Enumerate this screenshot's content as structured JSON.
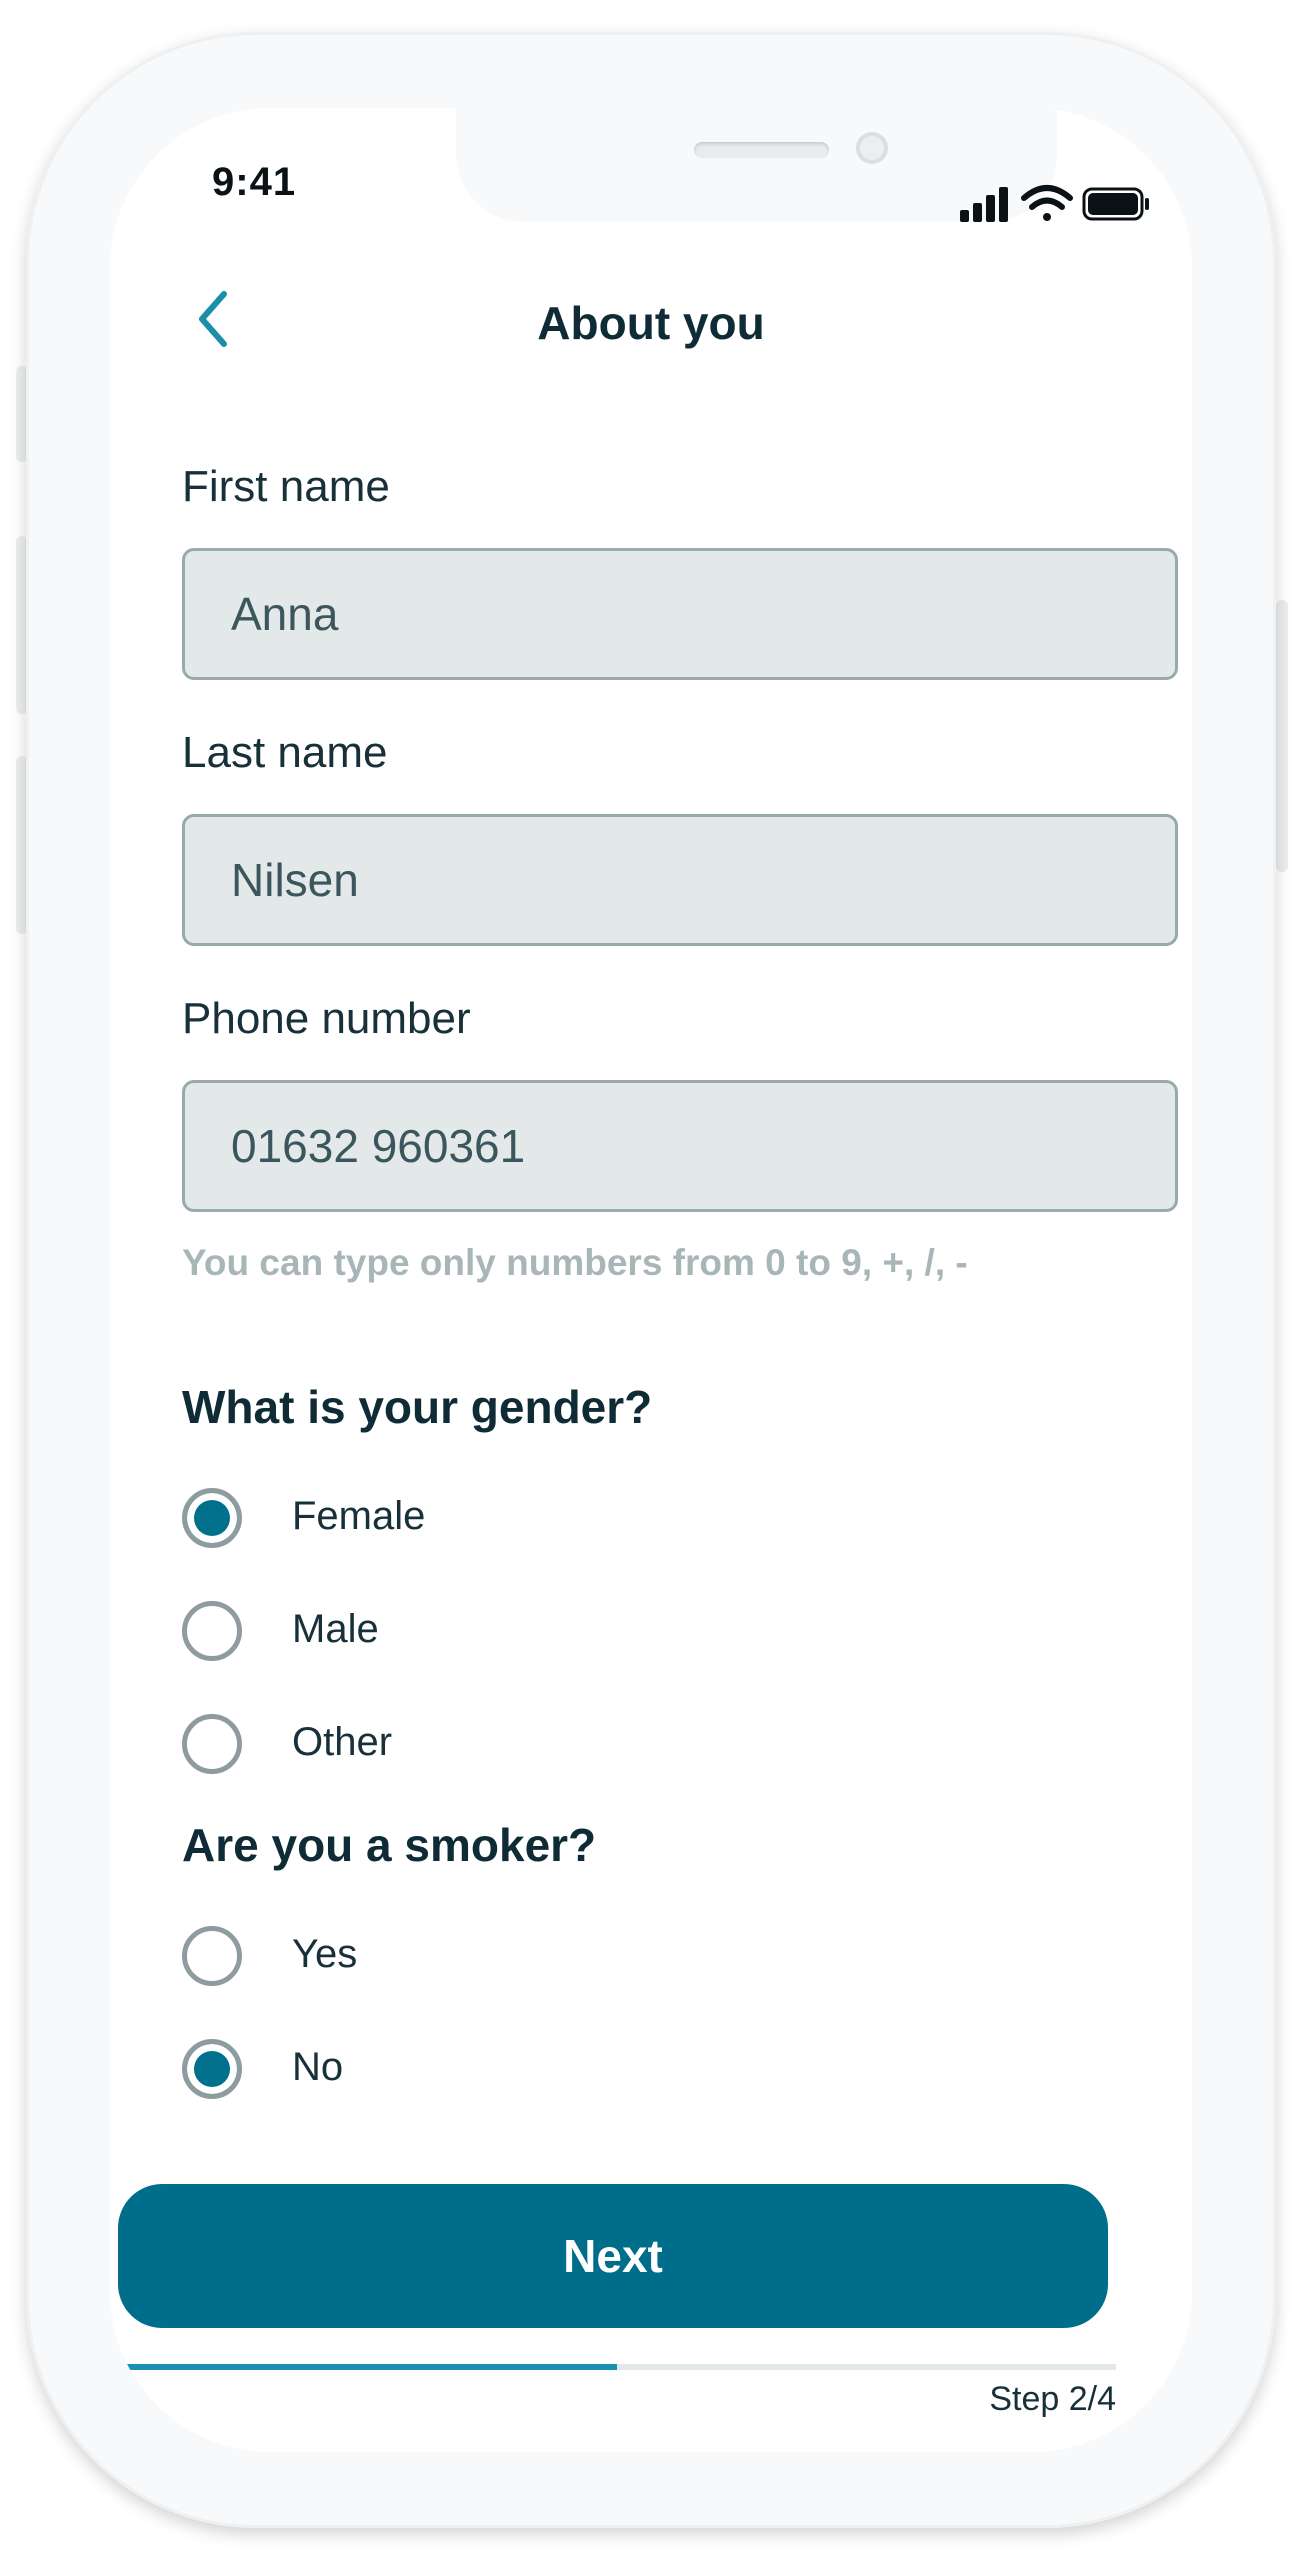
{
  "status_bar": {
    "time": "9:41",
    "signal_icon": "cellular-signal-icon",
    "wifi_icon": "wifi-icon",
    "battery_icon": "battery-icon"
  },
  "header": {
    "back_icon": "chevron-left-icon",
    "title": "About you"
  },
  "form": {
    "first_name": {
      "label": "First name",
      "value": "Anna"
    },
    "last_name": {
      "label": "Last name",
      "value": "Nilsen"
    },
    "phone": {
      "label": "Phone number",
      "value": "01632 960361",
      "hint": "You can type only numbers from 0 to 9, +, /, -"
    }
  },
  "gender": {
    "question": "What is your gender?",
    "options": [
      {
        "label": "Female",
        "selected": true
      },
      {
        "label": "Male",
        "selected": false
      },
      {
        "label": "Other",
        "selected": false
      }
    ]
  },
  "smoker": {
    "question": "Are you a smoker?",
    "options": [
      {
        "label": "Yes",
        "selected": false
      },
      {
        "label": "No",
        "selected": true
      }
    ]
  },
  "next_button": {
    "label": "Next"
  },
  "progress": {
    "fraction": 0.5,
    "step_label": "Step 2/4"
  },
  "colors": {
    "accent": "#006d8a",
    "progress_fill": "#1990b4",
    "field_bg": "#e3e8e8",
    "text": "#0f2b35",
    "hint": "#a9b6b8"
  }
}
